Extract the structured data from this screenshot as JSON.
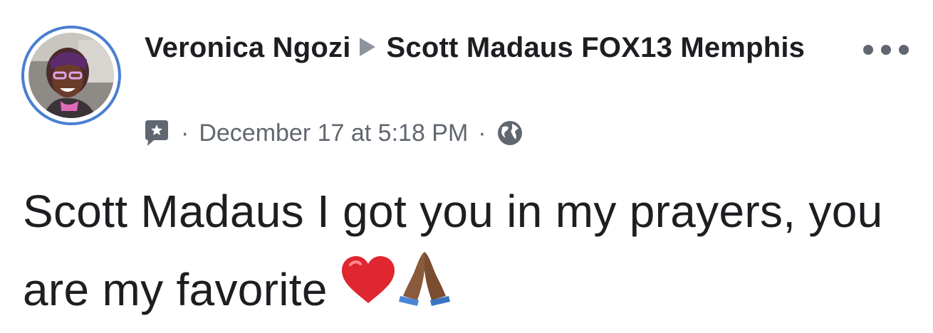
{
  "post": {
    "author": "Veronica Ngozi",
    "target": "Scott Madaus FOX13 Memphis",
    "timestamp": "December 17 at 5:18 PM",
    "separator": "·",
    "privacy_icon": "globe-icon",
    "post_type_icon": "comment-star-icon",
    "menu_icon": "more-options-icon",
    "content_text": "Scott Madaus I got you in my prayers, you are my favorite",
    "emojis": [
      "red-heart-emoji",
      "folded-hands-emoji"
    ]
  },
  "colors": {
    "avatar_ring": "#4a7fd0",
    "meta_text": "#606770",
    "arrow": "#8d949e",
    "heart": "#e0262f"
  }
}
